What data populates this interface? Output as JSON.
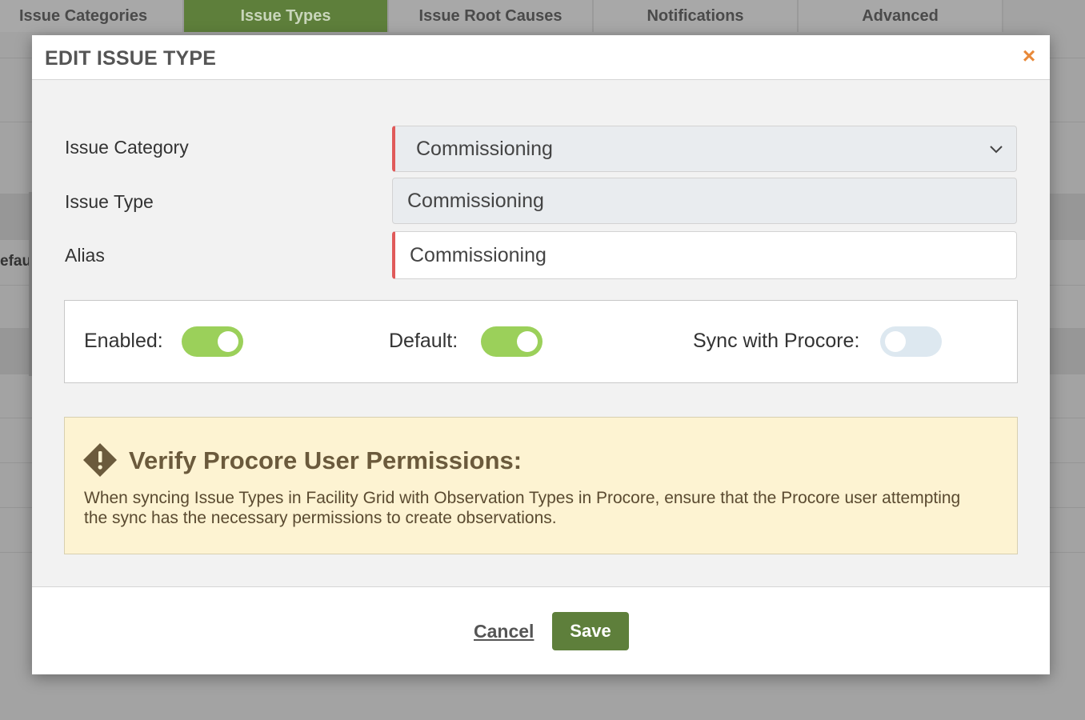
{
  "background": {
    "tabs": [
      {
        "label": "Issue Categories",
        "active": false
      },
      {
        "label": "Issue Types",
        "active": true
      },
      {
        "label": "Issue Root Causes",
        "active": false
      },
      {
        "label": "Notifications",
        "active": false
      },
      {
        "label": "Advanced",
        "active": false
      }
    ],
    "partial_text": "efaul"
  },
  "modal": {
    "title": "EDIT ISSUE TYPE",
    "close_label": "×",
    "fields": {
      "issue_category": {
        "label": "Issue Category",
        "value": "Commissioning"
      },
      "issue_type": {
        "label": "Issue Type",
        "value": "Commissioning"
      },
      "alias": {
        "label": "Alias",
        "value": "Commissioning"
      }
    },
    "toggles": {
      "enabled": {
        "label": "Enabled:",
        "on": true
      },
      "default": {
        "label": "Default:",
        "on": true
      },
      "sync": {
        "label": "Sync with Procore:",
        "on": false
      }
    },
    "warning": {
      "title": "Verify Procore User Permissions:",
      "body": "When syncing Issue Types in Facility Grid with Observation Types in Procore, ensure that the Procore user attempting the sync has the necessary permissions to create observations."
    },
    "footer": {
      "cancel_label": "Cancel",
      "save_label": "Save"
    }
  },
  "colors": {
    "accent_green": "#5e7f3b",
    "toggle_on": "#9bd05a",
    "toggle_off": "#dde8f0",
    "required_border": "#e05a5a",
    "close_orange": "#e8893a",
    "warning_bg": "#fdf3d2"
  },
  "icons": {
    "close": "close-icon",
    "dropdown": "chevron-down-icon",
    "warning": "warning-diamond-icon"
  }
}
